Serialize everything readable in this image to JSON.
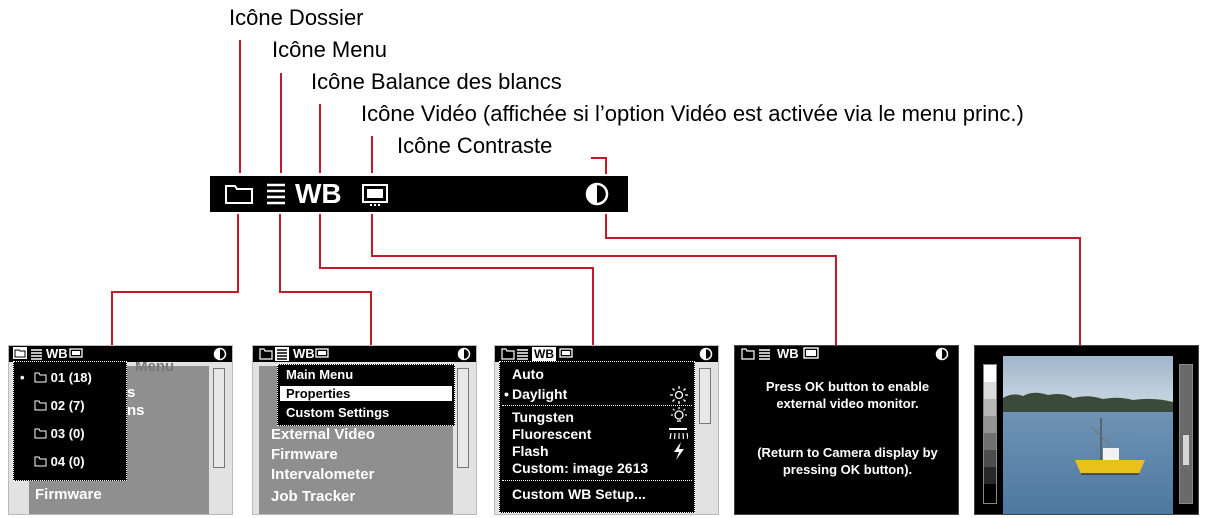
{
  "callouts": {
    "folder": "Icône Dossier",
    "menu": "Icône Menu",
    "wb": "Icône Balance des blancs",
    "video": "Icône Vidéo (affichée si l’option Vidéo est activée via le menu princ.)",
    "contrast": "Icône Contraste"
  },
  "toolbar": {
    "wb_label": "WB"
  },
  "screen1": {
    "behind": [
      "Menu",
      "s",
      "ns",
      "Firmware"
    ],
    "folders": [
      {
        "label": "01 (18)",
        "active": true
      },
      {
        "label": "02 (7)",
        "active": false
      },
      {
        "label": "03 (0)",
        "active": false
      },
      {
        "label": "04 (0)",
        "active": false
      }
    ]
  },
  "screen2": {
    "menu": [
      "Main Menu",
      "Properties",
      "Custom Settings"
    ],
    "selected": "Properties",
    "behind": [
      "External Video",
      "Firmware",
      "Intervalometer",
      "Job Tracker"
    ]
  },
  "screen3": {
    "items": [
      "Auto",
      "Daylight",
      "Tungsten",
      "Fluorescent",
      "Flash",
      "Custom: image 2613"
    ],
    "selected": "Daylight",
    "setup": "Custom WB Setup..."
  },
  "screen4": {
    "message1": "Press OK button to enable external video monitor.",
    "message2": "(Return to Camera display by pressing OK button)."
  },
  "colors": {
    "connector": "#c4182b",
    "bar": "#000000",
    "panel_gray": "#8f8f8f"
  }
}
